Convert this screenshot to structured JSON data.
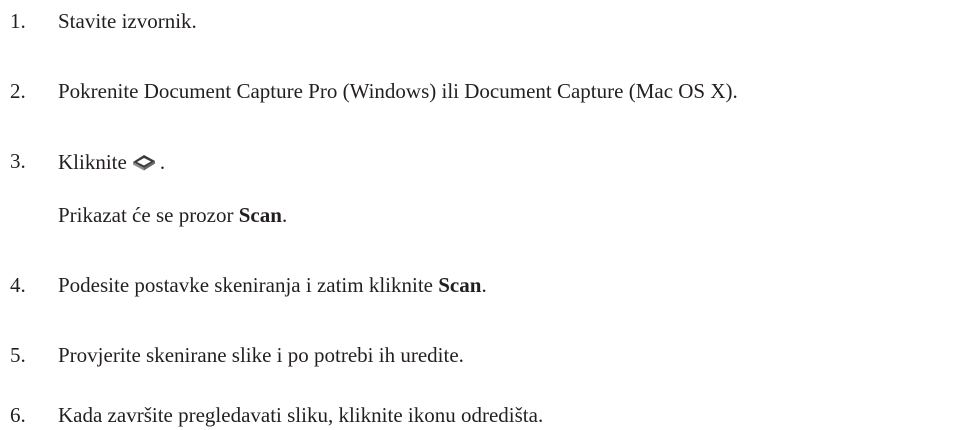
{
  "steps": [
    {
      "number": "1.",
      "text": "Stavite izvornik."
    },
    {
      "number": "2.",
      "text": "Pokrenite Document Capture Pro (Windows) ili Document Capture (Mac OS X)."
    },
    {
      "number": "3.",
      "text_before": "Kliknite",
      "icon": "scanner-icon",
      "text_after": ".",
      "note_before": "Prikazat će se prozor ",
      "note_bold": "Scan",
      "note_after": "."
    },
    {
      "number": "4.",
      "text_before": "Podesite postavke skeniranja i zatim kliknite ",
      "text_bold": "Scan",
      "text_after": "."
    },
    {
      "number": "5.",
      "text": "Provjerite skenirane slike i po potrebi ih uredite."
    },
    {
      "number": "6.",
      "text": "Kada završite pregledavati sliku, kliknite ikonu odredišta."
    }
  ]
}
